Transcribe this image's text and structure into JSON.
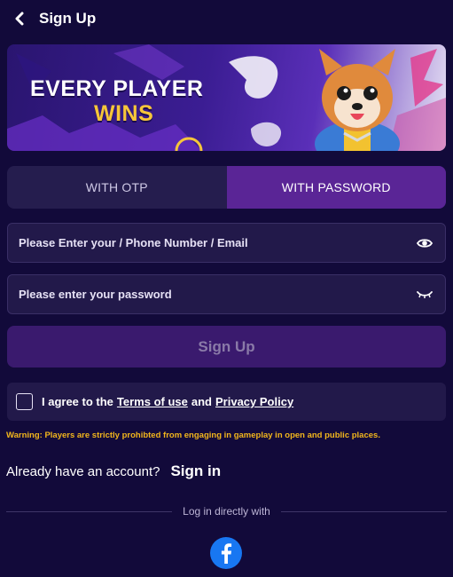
{
  "header": {
    "title": "Sign Up"
  },
  "banner": {
    "line1": "EVERY PLAYER",
    "line2": "WINS"
  },
  "tabs": [
    {
      "label": "WITH OTP",
      "active": false
    },
    {
      "label": "WITH PASSWORD",
      "active": true
    }
  ],
  "inputs": {
    "account": {
      "placeholder": "Please Enter your / Phone Number / Email",
      "value": ""
    },
    "password": {
      "placeholder": "Please enter your password",
      "value": ""
    }
  },
  "signup_button": {
    "label": "Sign Up"
  },
  "agree": {
    "prefix": "I agree to the",
    "terms_link": "Terms of use",
    "conjunction": "and",
    "privacy_link": "Privacy Policy",
    "checked": false
  },
  "warning": "Warning: Players are strictly prohibted from engaging in gameplay in open and public places.",
  "account_prompt": {
    "text": "Already have an account?",
    "link": "Sign in"
  },
  "divider": {
    "label": "Log in directly with"
  },
  "social": [
    {
      "name": "facebook",
      "icon": "facebook-icon",
      "color": "#1877f2"
    }
  ],
  "colors": {
    "background": "#120a3a",
    "tab_active": "#5a2596",
    "button": "#3a1a6e",
    "warning": "#f2b61c"
  }
}
